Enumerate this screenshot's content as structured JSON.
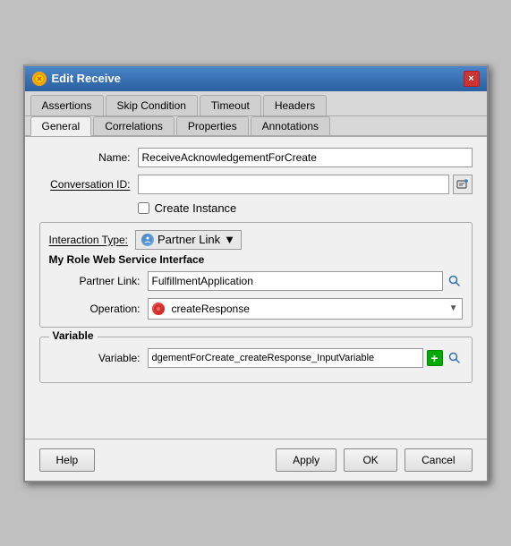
{
  "dialog": {
    "title": "Edit Receive",
    "close_label": "×"
  },
  "tabs_row1": {
    "tabs": [
      {
        "id": "assertions",
        "label": "Assertions",
        "active": false
      },
      {
        "id": "skip-condition",
        "label": "Skip Condition",
        "active": false
      },
      {
        "id": "timeout",
        "label": "Timeout",
        "active": false
      },
      {
        "id": "headers",
        "label": "Headers",
        "active": false
      }
    ]
  },
  "tabs_row2": {
    "tabs": [
      {
        "id": "general",
        "label": "General",
        "active": true
      },
      {
        "id": "correlations",
        "label": "Correlations",
        "active": false
      },
      {
        "id": "properties",
        "label": "Properties",
        "active": false
      },
      {
        "id": "annotations",
        "label": "Annotations",
        "active": false
      }
    ]
  },
  "form": {
    "name_label": "Name:",
    "name_value": "ReceiveAcknowledgementForCreate",
    "conversation_label": "Conversation ID:",
    "conversation_value": "",
    "create_instance_label": "Create Instance",
    "interaction_type_label": "Interaction Type:",
    "partner_link_btn_label": "Partner Link",
    "my_role_label": "My Role Web Service Interface",
    "partner_link_label": "Partner Link:",
    "partner_link_value": "FulfillmentApplication",
    "operation_label": "Operation:",
    "operation_value": "createResponse",
    "variable_section_label": "Variable",
    "variable_label": "Variable:",
    "variable_value": "dgementForCreate_createResponse_InputVariable"
  },
  "footer": {
    "help_label": "Help",
    "apply_label": "Apply",
    "ok_label": "OK",
    "cancel_label": "Cancel"
  }
}
